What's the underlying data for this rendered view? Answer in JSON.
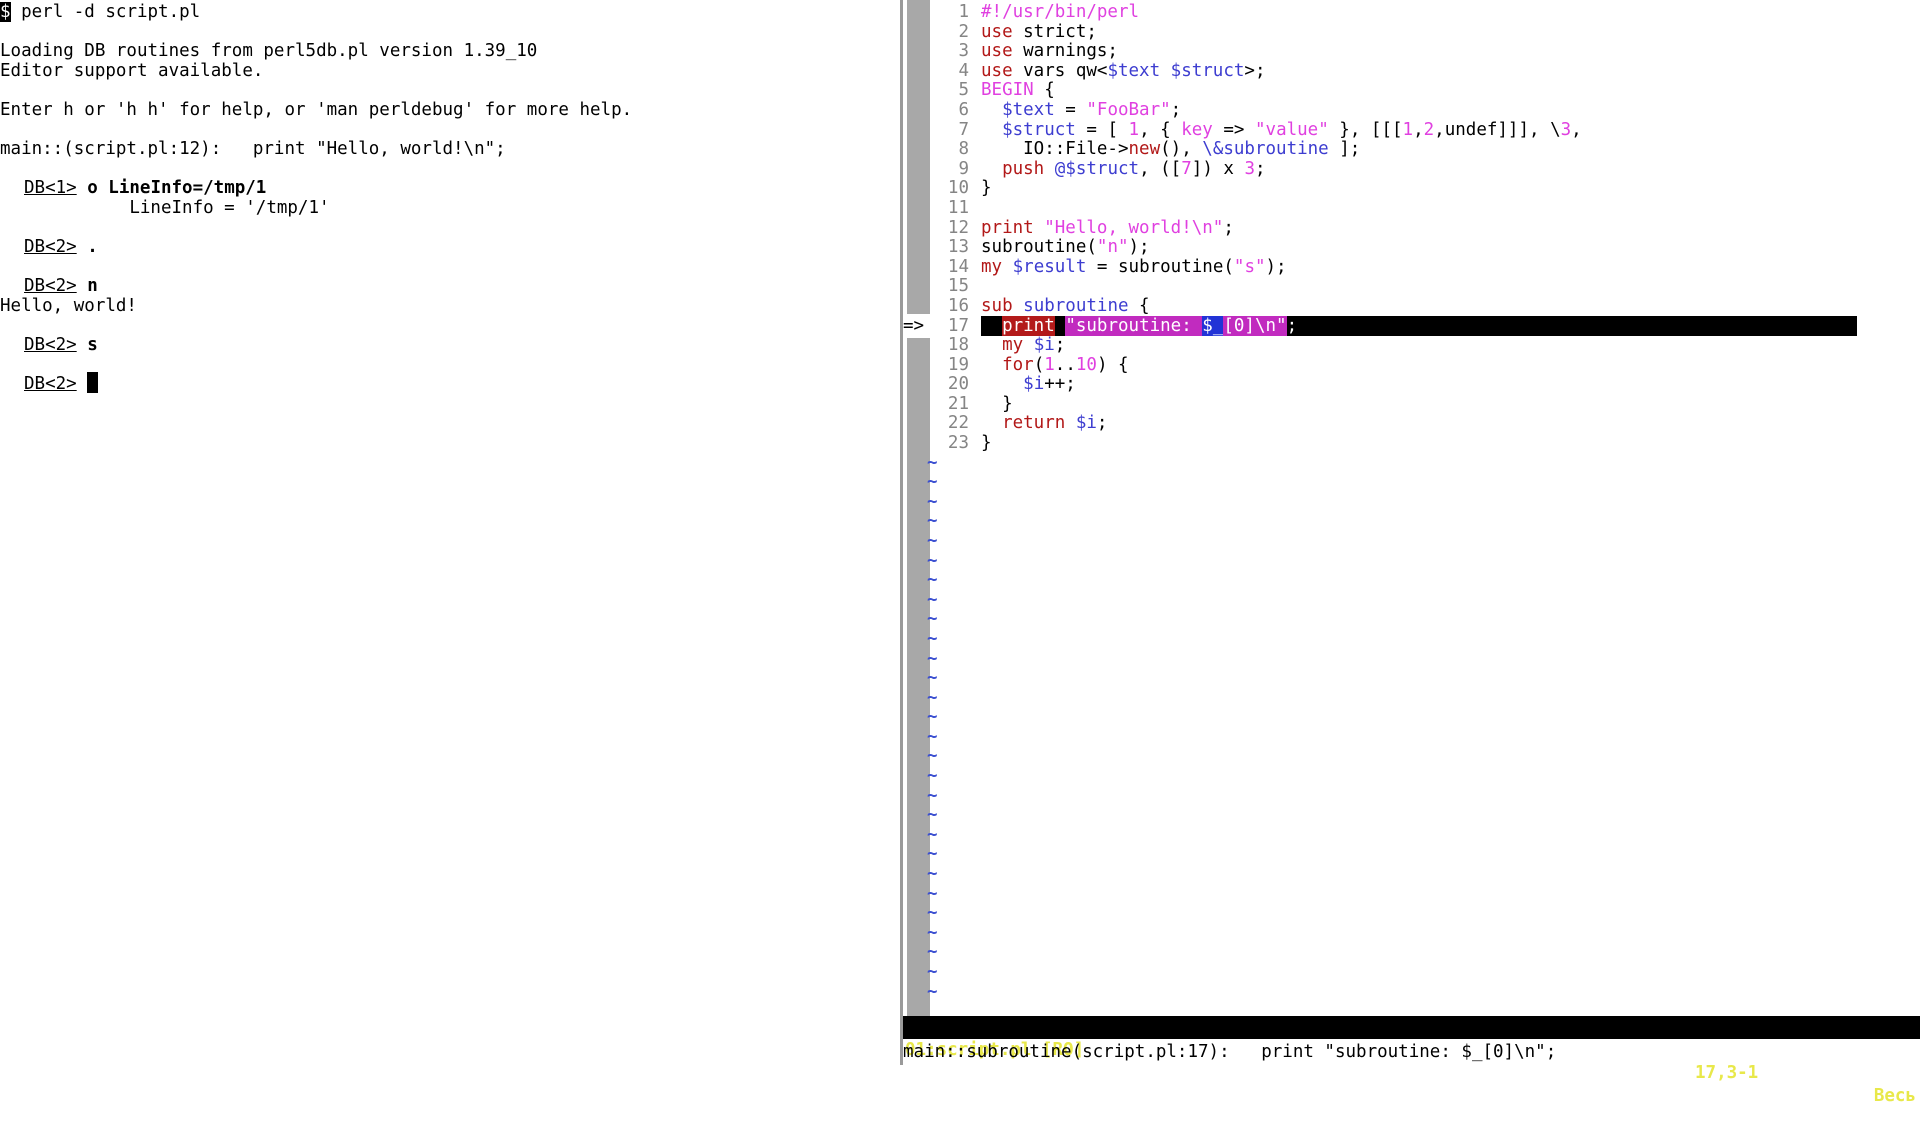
{
  "terminal": {
    "prompt_symbol": "$",
    "command": " perl -d script.pl",
    "loading_line": "Loading DB routines from perl5db.pl version 1.39_10",
    "editor_line": "Editor support available.",
    "help_line": "Enter h or 'h h' for help, or 'man perldebug' for more help.",
    "main_line": "main::(script.pl:12):   print \"Hello, world!\\n\";",
    "db1_prompt": "DB<1>",
    "db1_cmd": "o LineInfo=/tmp/1",
    "lineinfo_output": "          LineInfo = '/tmp/1'",
    "db2_prompt": "DB<2>",
    "db2a_cmd": ".",
    "db2b_cmd": "n",
    "hello_output": "Hello, world!",
    "db2c_cmd": "s",
    "db2d_cmd": ""
  },
  "vim": {
    "current_line_marker": "=>",
    "line_numbers": [
      "1",
      "2",
      "3",
      "4",
      "5",
      "6",
      "7",
      "8",
      "9",
      "10",
      "11",
      "12",
      "13",
      "14",
      "15",
      "16",
      "17",
      "18",
      "19",
      "20",
      "21",
      "22",
      "23"
    ],
    "code": {
      "l1": "#!/usr/bin/perl",
      "l2a": "use",
      "l2b": " strict;",
      "l3a": "use",
      "l3b": " warnings;",
      "l4a": "use",
      "l4b": " vars ",
      "l4c": "qw<",
      "l4d": "$text $struct",
      "l4e": ">;",
      "l5a": "BEGIN",
      "l5b": " {",
      "l6a": "  ",
      "l6b": "$text",
      "l6c": " = ",
      "l6d": "\"FooBar\"",
      "l6e": ";",
      "l7a": "  ",
      "l7b": "$struct",
      "l7c": " = [ ",
      "l7d": "1",
      "l7e": ", { ",
      "l7f": "key",
      "l7g": " => ",
      "l7h": "\"value\"",
      "l7i": " }, [[[",
      "l7j": "1",
      "l7k": ",",
      "l7l": "2",
      "l7m": ",undef]]], \\",
      "l7n": "3",
      "l7o": ",",
      "l8a": "    IO::File->",
      "l8b": "new",
      "l8c": "(), ",
      "l8d": "\\&subroutine",
      "l8e": " ];",
      "l9a": "  ",
      "l9b": "push",
      "l9c": " ",
      "l9d": "@$struct",
      "l9e": ", ([",
      "l9f": "7",
      "l9g": "]) x ",
      "l9h": "3",
      "l9i": ";",
      "l10": "}",
      "l11": "",
      "l12a": "print",
      "l12b": " ",
      "l12c": "\"Hello, world!\\n\"",
      "l12d": ";",
      "l13a": "subroutine(",
      "l13b": "\"n\"",
      "l13c": ");",
      "l14a": "my",
      "l14b": " ",
      "l14c": "$result",
      "l14d": " = subroutine(",
      "l14e": "\"s\"",
      "l14f": ");",
      "l15": "",
      "l16a": "sub",
      "l16b": " ",
      "l16c": "subroutine",
      "l16d": " {",
      "l17a": "  ",
      "l17b": "print",
      "l17c": " ",
      "l17d": "\"subroutine: ",
      "l17e": "$_",
      "l17f": "[0]\\n\"",
      "l17g": ";",
      "l18a": "  ",
      "l18b": "my",
      "l18c": " ",
      "l18d": "$i",
      "l18e": ";",
      "l19a": "  ",
      "l19b": "for",
      "l19c": "(",
      "l19d": "1",
      "l19e": "..",
      "l19f": "10",
      "l19g": ") {",
      "l20a": "    ",
      "l20b": "$i",
      "l20c": "++;",
      "l21": "  }",
      "l22a": "  ",
      "l22b": "return",
      "l22c": " ",
      "l22d": "$i",
      "l22e": ";",
      "l23": "}"
    },
    "tilde": "~",
    "status": {
      "file": "01:script.pl [RO]",
      "position": "17,3-1",
      "percent": "Весь"
    },
    "cmdline": "main::subroutine(script.pl:17):   print \"subroutine: $_[0]\\n\";"
  }
}
